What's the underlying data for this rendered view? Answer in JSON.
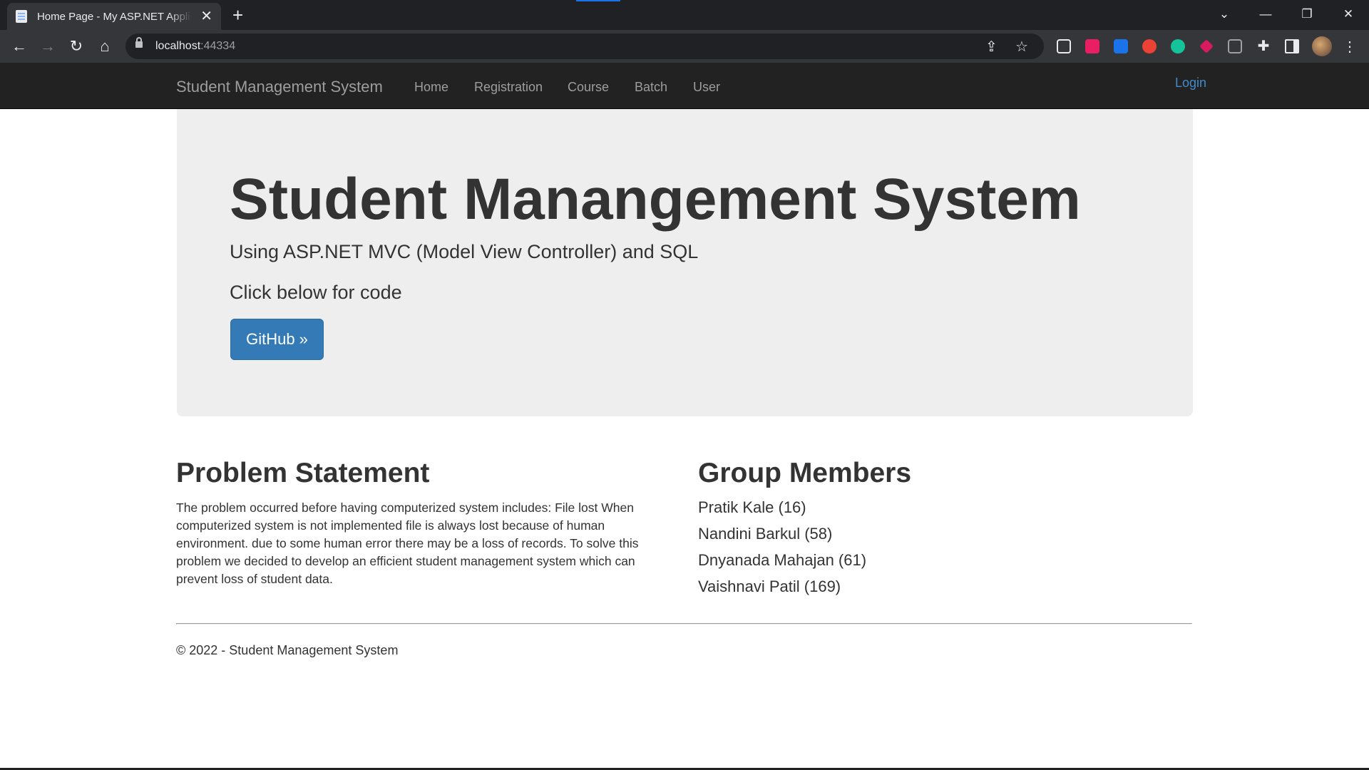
{
  "browser": {
    "tab_title": "Home Page - My ASP.NET Application",
    "url_host": "localhost",
    "url_port": ":44334",
    "icons": {
      "back": "arrow-left-icon",
      "forward": "arrow-right-icon",
      "reload": "reload-icon",
      "home": "home-icon",
      "share": "share-icon",
      "bookmark": "star-icon",
      "extensions": "puzzle-icon"
    }
  },
  "navbar": {
    "brand": "Student Management System",
    "links": [
      "Home",
      "Registration",
      "Course",
      "Batch",
      "User"
    ],
    "login": "Login"
  },
  "jumbotron": {
    "title": "Student Manangement System",
    "lead": "Using ASP.NET MVC (Model View Controller) and SQL",
    "text": "Click below for code",
    "button": "GitHub »"
  },
  "problem": {
    "heading": "Problem Statement",
    "body": "The problem occurred before having computerized system includes: File lost When computerized system is not implemented file is always lost because of human environment. due to some human error there may be a loss of records. To solve this problem we decided to develop an efficient student management system which can prevent loss of student data."
  },
  "group": {
    "heading": "Group Members",
    "members": [
      "Pratik Kale (16)",
      "Nandini Barkul (58)",
      "Dnyanada Mahajan (61)",
      "Vaishnavi Patil (169)"
    ]
  },
  "footer": {
    "text": "© 2022 - Student Management System"
  },
  "colors": {
    "navbar_bg": "#222222",
    "jumbotron_bg": "#eeeeee",
    "primary": "#337ab7",
    "link": "#428bca"
  }
}
